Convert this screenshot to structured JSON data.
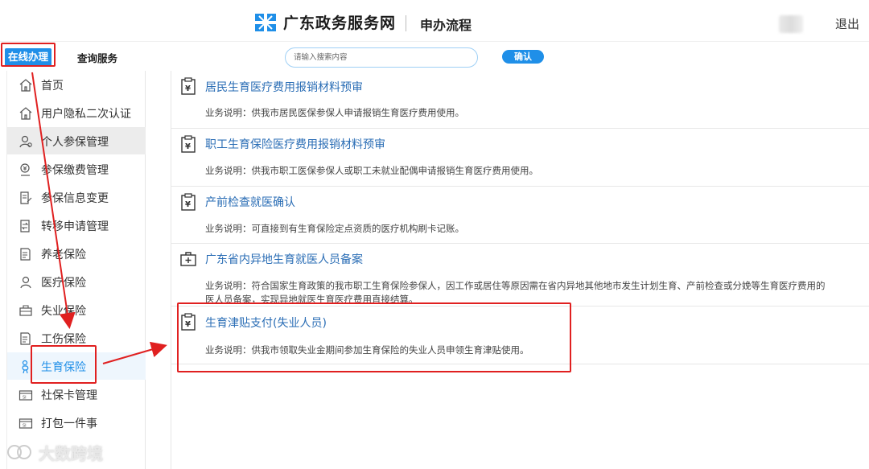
{
  "header": {
    "site_name": "广东政务服务网",
    "subtitle": "申办流程",
    "logout": "退出"
  },
  "subnav": {
    "tab_online": "在线办理",
    "tab_query": "查询服务",
    "search_placeholder": "请输入搜索内容",
    "confirm": "确认"
  },
  "sidebar": {
    "items": [
      {
        "label": "首页",
        "icon": "home-icon"
      },
      {
        "label": "用户隐私二次认证",
        "icon": "home-icon"
      },
      {
        "label": "个人参保管理",
        "icon": "person-group-icon"
      },
      {
        "label": "参保缴费管理",
        "icon": "coin-person-icon"
      },
      {
        "label": "参保信息变更",
        "icon": "edit-document-icon"
      },
      {
        "label": "转移申请管理",
        "icon": "transfer-icon"
      },
      {
        "label": "养老保险",
        "icon": "document-icon"
      },
      {
        "label": "医疗保险",
        "icon": "person-icon"
      },
      {
        "label": "失业保险",
        "icon": "briefcase-icon"
      },
      {
        "label": "工伤保险",
        "icon": "document-icon"
      },
      {
        "label": "生育保险",
        "icon": "pregnant-person-icon"
      },
      {
        "label": "社保卡管理",
        "icon": "card-icon"
      },
      {
        "label": "打包一件事",
        "icon": "card-icon"
      }
    ],
    "grey_index": 2,
    "active_index": 10
  },
  "services": [
    {
      "title": "居民生育医疗费用报销材料预审",
      "desc": "业务说明：供我市居民医保参保人申请报销生育医疗费用使用。",
      "icon": "yen-clipboard-icon"
    },
    {
      "title": "职工生育保险医疗费用报销材料预审",
      "desc": "业务说明：供我市职工医保参保人或职工未就业配偶申请报销生育医疗费用使用。",
      "icon": "yen-clipboard-icon"
    },
    {
      "title": "产前检查就医确认",
      "desc": "业务说明：可直接到有生育保险定点资质的医疗机构刷卡记账。",
      "icon": "yen-clipboard-icon"
    },
    {
      "title": "广东省内异地生育就医人员备案",
      "desc": "业务说明：符合国家生育政策的我市职工生育保险参保人，因工作或居住等原因需在省内异地其他地市发生计划生育、产前检查或分娩等生育医疗费用的",
      "desc2": "医人员备案，实现异地就医生育医疗费用直接结算。",
      "icon": "medical-kit-icon"
    },
    {
      "title": "生育津贴支付(失业人员)",
      "desc": "业务说明：供我市领取失业金期间参加生育保险的失业人员申领生育津贴使用。",
      "icon": "yen-clipboard-icon"
    }
  ],
  "watermark": "大数跨境",
  "colors": {
    "accent": "#1f8fe8",
    "annotation": "#e02020",
    "link": "#2a6db5"
  }
}
